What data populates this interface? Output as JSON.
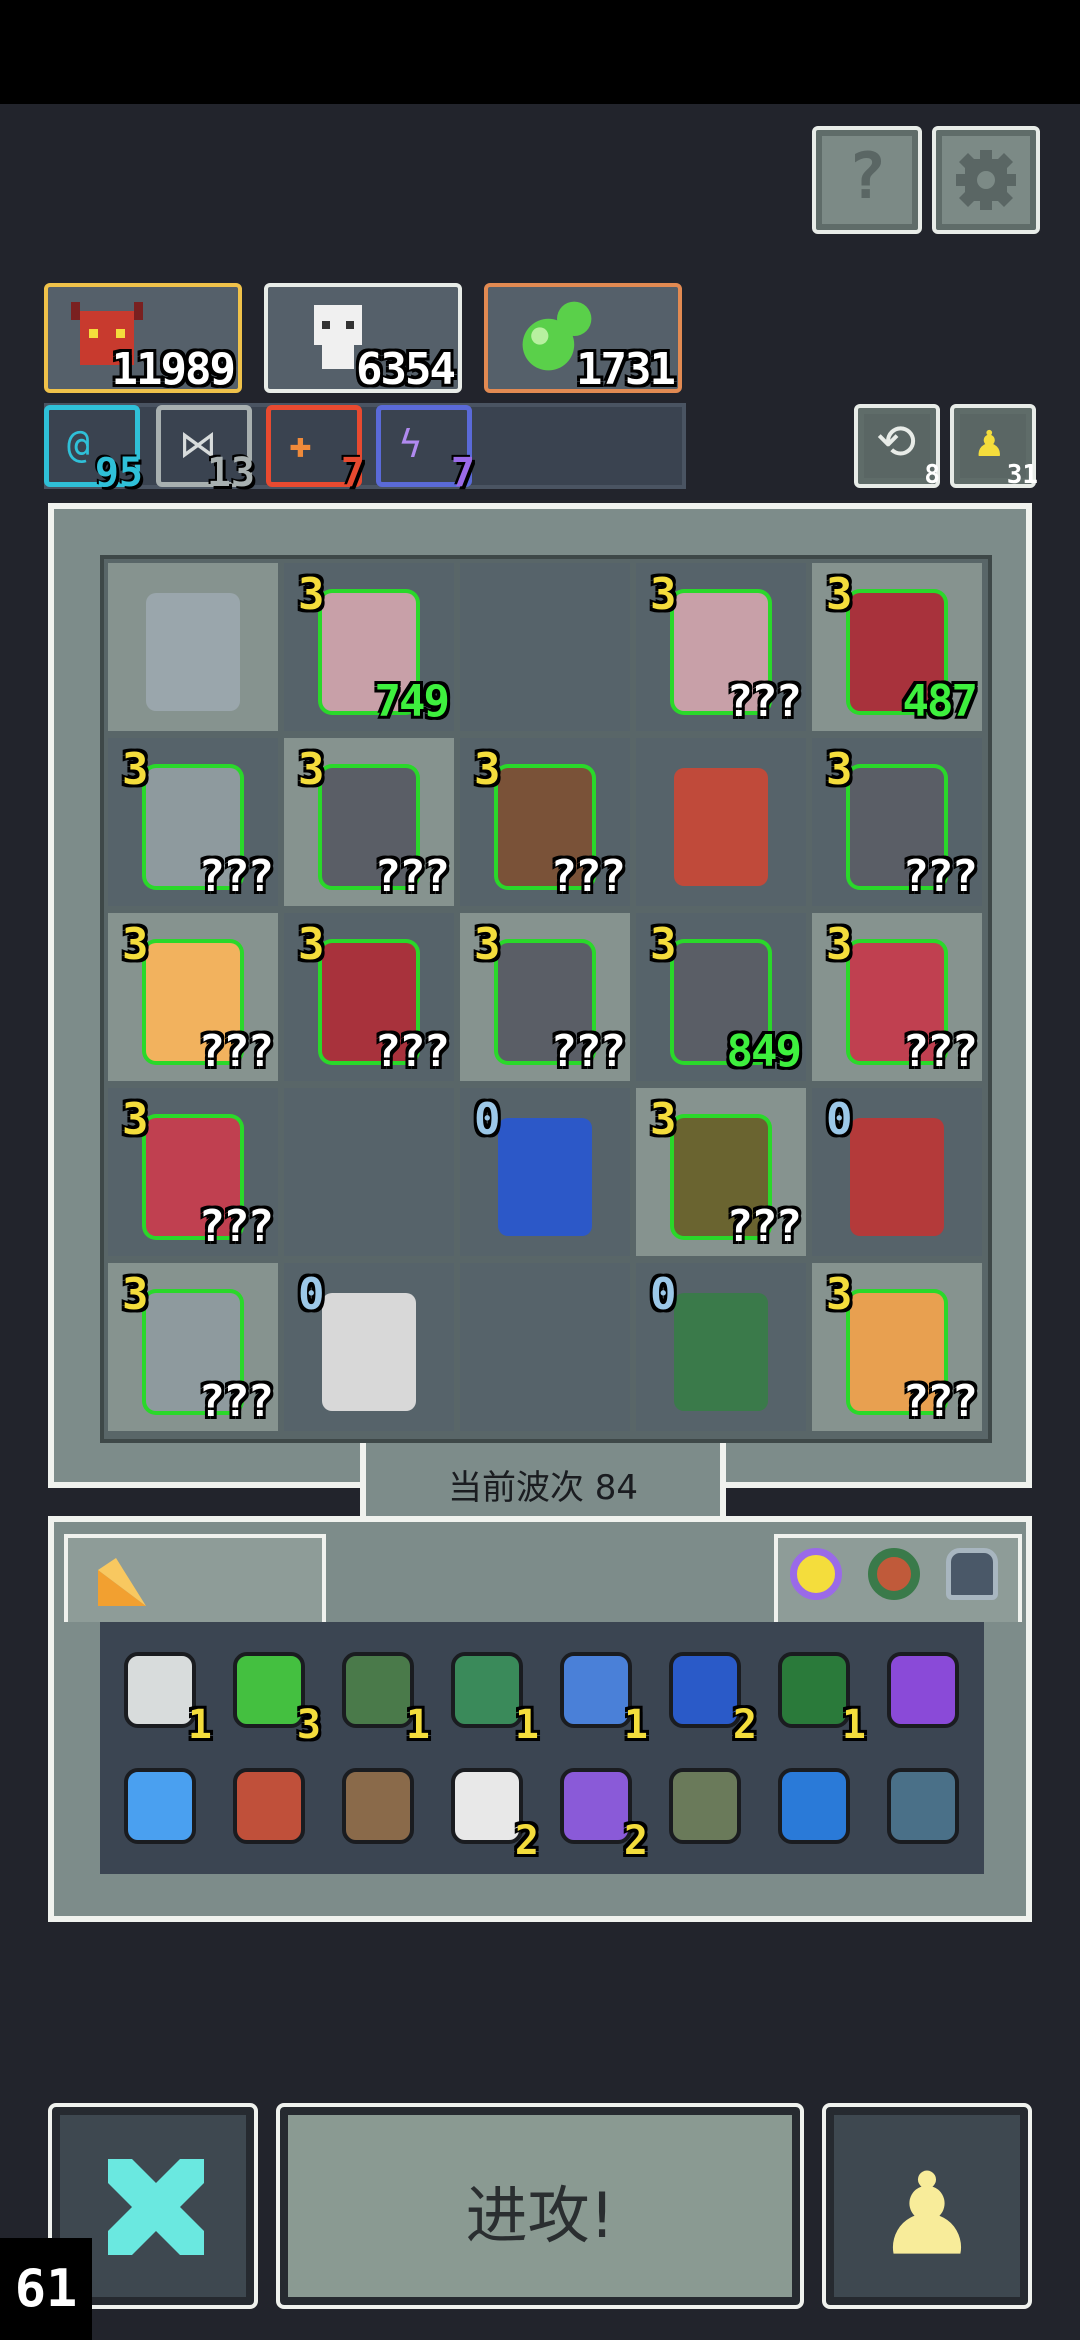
{
  "top": {
    "help_label": "?",
    "settings_icon": "gear-icon"
  },
  "resources": [
    {
      "id": "boss",
      "value": "11989",
      "border": "#f0c24a"
    },
    {
      "id": "skull",
      "value": "6354",
      "border": "#e8ece8"
    },
    {
      "id": "gem",
      "value": "1731",
      "border": "#e28a52"
    }
  ],
  "chips": [
    {
      "id": "cyan",
      "value": "95",
      "color": "#2fc0d8"
    },
    {
      "id": "grey",
      "value": "13",
      "color": "#a8b0b0"
    },
    {
      "id": "red",
      "value": "7",
      "color": "#e84a30"
    },
    {
      "id": "purple",
      "value": "7",
      "color": "#9a6ae8"
    }
  ],
  "counters": [
    {
      "id": "reroll",
      "value": "8"
    },
    {
      "id": "pawn",
      "value": "31"
    }
  ],
  "board": {
    "rows": [
      [
        {
          "lvl": "",
          "val": "",
          "unit": "#9aa6ac"
        },
        {
          "lvl": "3",
          "val": "749",
          "green": true,
          "unit": "#c8a0a8"
        },
        {
          "lvl": "",
          "val": "",
          "unit": "",
          "dark": true
        },
        {
          "lvl": "3",
          "val": "???",
          "unit": "#c8a0a8"
        },
        {
          "lvl": "3",
          "val": "487",
          "green": true,
          "unit": "#a8323c"
        }
      ],
      [
        {
          "lvl": "3",
          "val": "???",
          "unit": "#8e9a9e"
        },
        {
          "lvl": "3",
          "val": "???",
          "unit": "#5a5e66"
        },
        {
          "lvl": "3",
          "val": "???",
          "unit": "#7a5238"
        },
        {
          "lvl": "",
          "val": "",
          "unit": "#c04a3a",
          "dark": true
        },
        {
          "lvl": "3",
          "val": "???",
          "unit": "#5a5e66"
        }
      ],
      [
        {
          "lvl": "3",
          "val": "???",
          "unit": "#f2b25e"
        },
        {
          "lvl": "3",
          "val": "???",
          "unit": "#a8323c"
        },
        {
          "lvl": "3",
          "val": "???",
          "unit": "#5a5e66"
        },
        {
          "lvl": "3",
          "val": "849",
          "green": true,
          "unit": "#5a5e66"
        },
        {
          "lvl": "3",
          "val": "???",
          "unit": "#c04050"
        }
      ],
      [
        {
          "lvl": "3",
          "val": "???",
          "unit": "#c04050"
        },
        {
          "lvl": "",
          "val": "",
          "unit": "",
          "dark": true
        },
        {
          "lvl": "0",
          "val": "",
          "blue": true,
          "unit": "#2c58c8"
        },
        {
          "lvl": "3",
          "val": "???",
          "unit": "#6a6430"
        },
        {
          "lvl": "0",
          "val": "",
          "blue": true,
          "unit": "#b43a3a"
        }
      ],
      [
        {
          "lvl": "3",
          "val": "???",
          "unit": "#8e9a9e"
        },
        {
          "lvl": "0",
          "val": "",
          "blue": true,
          "unit": "#d8d8d8"
        },
        {
          "lvl": "",
          "val": "",
          "unit": "",
          "dark": true
        },
        {
          "lvl": "0",
          "val": "",
          "blue": true,
          "unit": "#3a7a4a"
        },
        {
          "lvl": "3",
          "val": "???",
          "unit": "#e8a050"
        }
      ]
    ]
  },
  "wave": {
    "label": "当前波次 84"
  },
  "inventory": {
    "tab_icon": "cheese-icon",
    "relics": [
      "ring-icon",
      "wreath-icon",
      "helmet-icon"
    ],
    "row1": [
      {
        "name": "scroll",
        "cnt": "1",
        "color": "#d8dcdc"
      },
      {
        "name": "emerald",
        "cnt": "3",
        "color": "#44c040"
      },
      {
        "name": "hooded",
        "cnt": "1",
        "color": "#4a7a4a"
      },
      {
        "name": "goblin",
        "cnt": "1",
        "color": "#3a8a5a"
      },
      {
        "name": "axe",
        "cnt": "1",
        "color": "#4a80d8"
      },
      {
        "name": "hourglass",
        "cnt": "2",
        "color": "#2a5ac8"
      },
      {
        "name": "devil",
        "cnt": "1",
        "color": "#2a7a3a"
      },
      {
        "name": "hammer",
        "cnt": "",
        "color": "#8a4ad8"
      }
    ],
    "row2": [
      {
        "name": "orb",
        "cnt": "",
        "color": "#4aa0f0"
      },
      {
        "name": "claw",
        "cnt": "",
        "color": "#c0503a"
      },
      {
        "name": "feather",
        "cnt": "",
        "color": "#8a6a4a"
      },
      {
        "name": "fang",
        "cnt": "2",
        "color": "#e8e8e8"
      },
      {
        "name": "potion",
        "cnt": "2",
        "color": "#8a5ad8"
      },
      {
        "name": "rock",
        "cnt": "",
        "color": "#6a7a5a"
      },
      {
        "name": "worm",
        "cnt": "",
        "color": "#2a7ad8"
      },
      {
        "name": "crown",
        "cnt": "",
        "color": "#4a7088"
      }
    ]
  },
  "bottom": {
    "attack_label": "进攻!",
    "fps": "61"
  }
}
